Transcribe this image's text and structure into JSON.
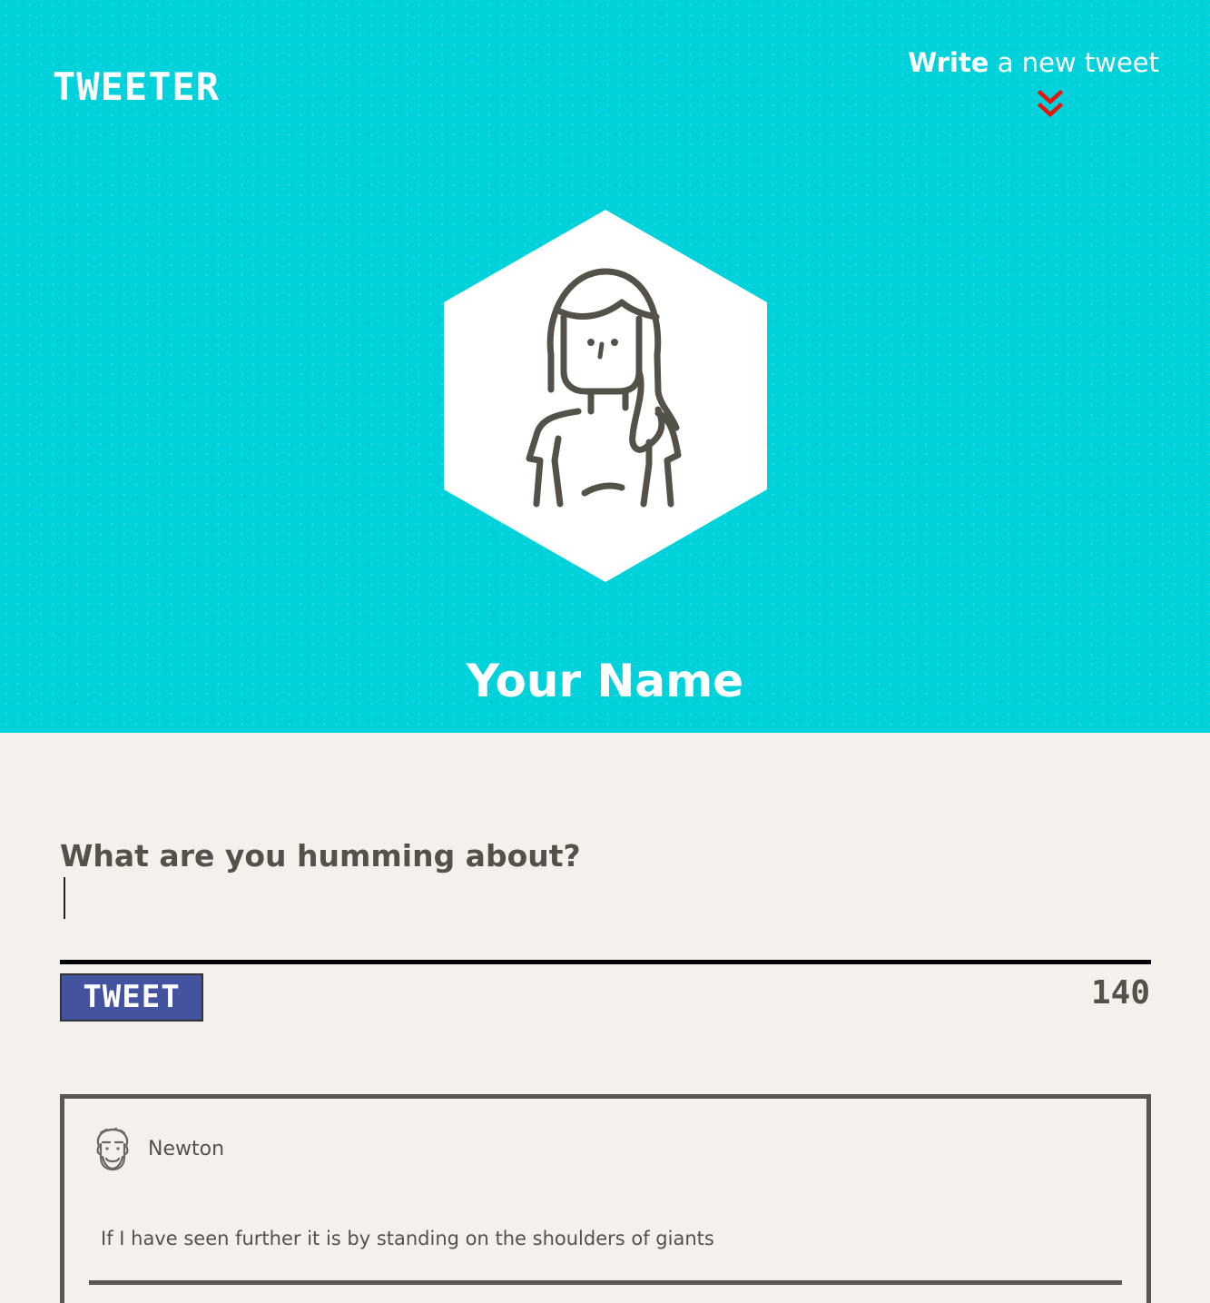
{
  "header": {
    "logo": "TWEETER",
    "compose_bold": "Write",
    "compose_rest": " a new tweet",
    "chevron_icon": "double-chevron-down-icon",
    "chevron_color": "#e8150d"
  },
  "profile": {
    "avatar_icon": "woman-avatar-icon",
    "name": "Your Name"
  },
  "composer": {
    "label": "What are you humming about?",
    "input_value": "",
    "button_label": "TWEET",
    "counter": "140"
  },
  "tweets": [
    {
      "author_icon": "bearded-man-avatar-icon",
      "author": "Newton",
      "text": "If I have seen further it is by standing on the shoulders of giants"
    }
  ],
  "colors": {
    "hero_background": "#00d2db",
    "page_background": "#f4f1ec",
    "text": "#545149",
    "button": "#4453a0"
  }
}
